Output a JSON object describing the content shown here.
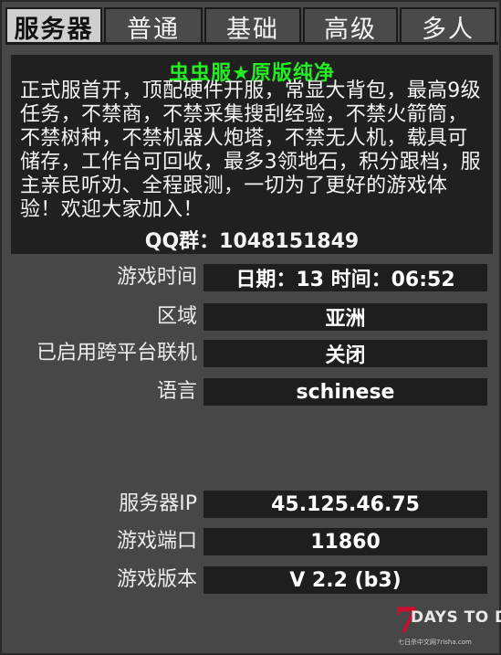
{
  "tabs": [
    {
      "label": "服务器",
      "active": true
    },
    {
      "label": "普通",
      "active": false
    },
    {
      "label": "基础",
      "active": false
    },
    {
      "label": "高级",
      "active": false
    },
    {
      "label": "多人",
      "active": false
    }
  ],
  "description": {
    "title": "虫虫服★原版纯净",
    "body": "正式服首开，顶配硬件开服，常显大背包，最高9级任务，不禁商，不禁采集搜刮经验，不禁火箭筒，不禁树种，不禁机器人炮塔，不禁无人机，载具可储存，工作台可回收，最多3领地石，积分跟档，服主亲民听劝、全程跟测，一切为了更好的游戏体验！欢迎大家加入！",
    "qq": "QQ群：1048151849"
  },
  "rows_top": [
    {
      "label": "游戏时间",
      "value": "日期：13 时间：06:52"
    },
    {
      "label": "区域",
      "value": "亚洲"
    },
    {
      "label": "已启用跨平台联机",
      "value": "关闭"
    },
    {
      "label": "语言",
      "value": "schinese"
    }
  ],
  "rows_bottom": [
    {
      "label": "服务器IP",
      "value": "45.125.46.75"
    },
    {
      "label": "游戏端口",
      "value": "11860"
    },
    {
      "label": "游戏版本",
      "value": "V 2.2 (b3)"
    }
  ],
  "logo": {
    "seven": "7",
    "text": "DAYS TO DIE",
    "sub": "七日杀中文网7risha.com"
  },
  "colors": {
    "title_green": "#22ee22",
    "active_tab": "#cfcfcf",
    "value_bg": "#1e1e1e",
    "logo_red": "#c8102e"
  }
}
